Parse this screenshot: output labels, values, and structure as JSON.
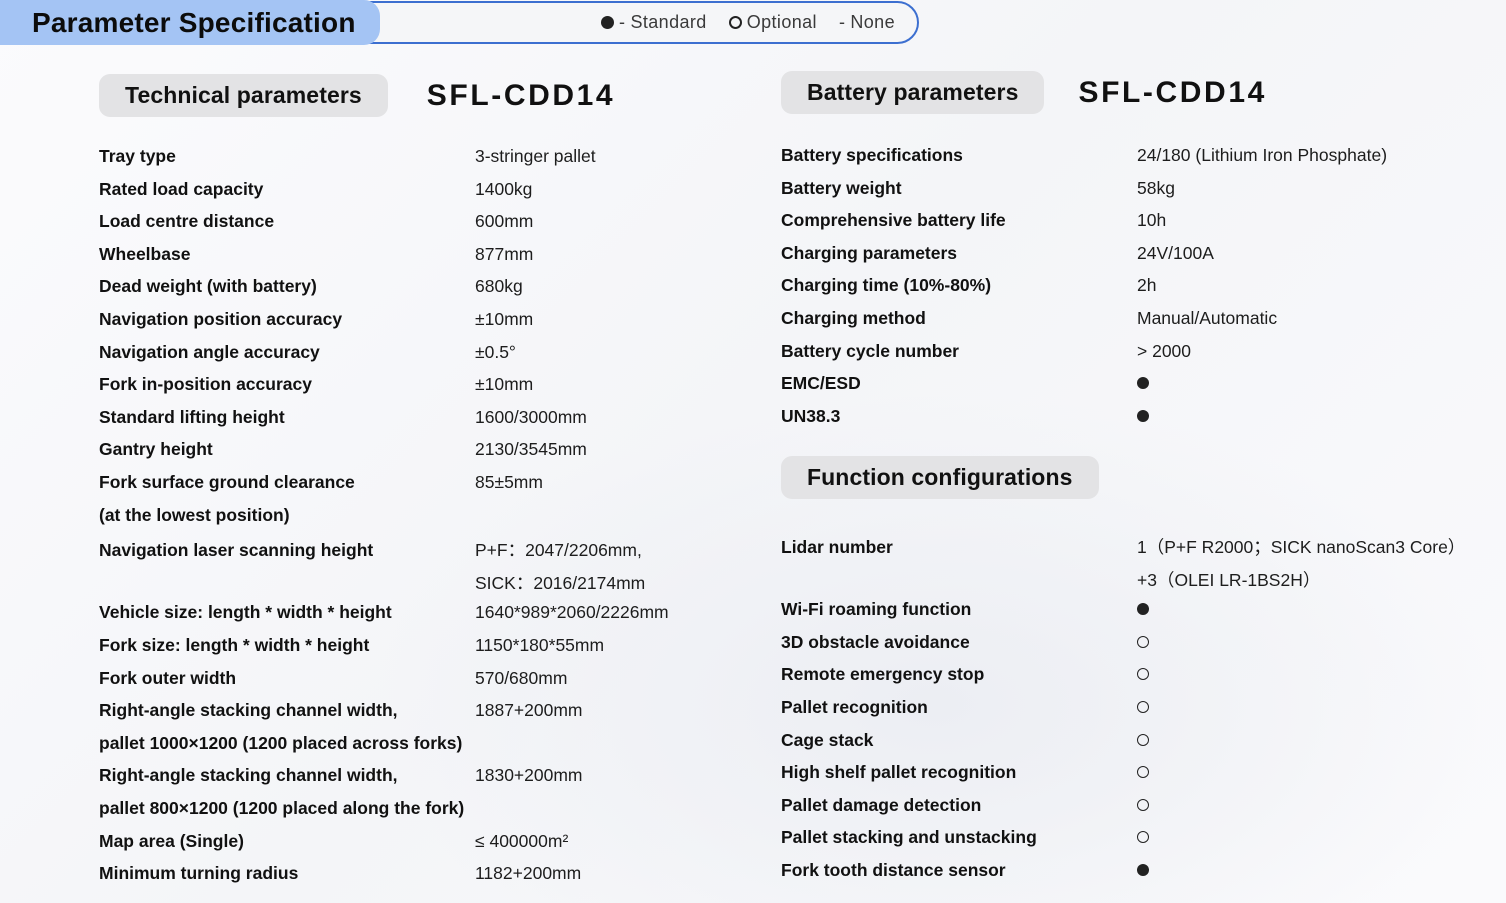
{
  "header": {
    "title": "Parameter Specification",
    "legend": [
      {
        "marker": "filled-dot",
        "dash": "-",
        "label": "Standard"
      },
      {
        "marker": "open-dot",
        "dash": "",
        "label": "Optional"
      },
      {
        "marker": "none",
        "dash": "-",
        "label": "None"
      }
    ]
  },
  "colors": {
    "title_badge": "#a4c4f4",
    "legend_border": "#3c6fd0",
    "pill": "#e3e3e5",
    "background": "#f7f7fa",
    "text": "#111111"
  },
  "sections": {
    "technical": {
      "heading": "Technical parameters",
      "model": "SFL-CDD14",
      "rows": [
        {
          "label": "Tray type",
          "value": "3-stringer pallet"
        },
        {
          "label": "Rated load capacity",
          "value": "1400kg"
        },
        {
          "label": "Load centre distance",
          "value": "600mm"
        },
        {
          "label": "Wheelbase",
          "value": "877mm"
        },
        {
          "label": "Dead weight (with battery)",
          "value": "680kg"
        },
        {
          "label": "Navigation position accuracy",
          "value": "±10mm"
        },
        {
          "label": "Navigation angle accuracy",
          "value": "±0.5°"
        },
        {
          "label": "Fork in-position accuracy",
          "value": "±10mm"
        },
        {
          "label": "Standard lifting height",
          "value": "1600/3000mm"
        },
        {
          "label": "Gantry height",
          "value": "2130/3545mm"
        },
        {
          "label": "Fork surface ground clearance",
          "value": "85±5mm"
        },
        {
          "label": "(at the lowest position)",
          "value": ""
        },
        {
          "label": "Navigation laser scanning height",
          "value": "P+F：2047/2206mm,"
        },
        {
          "label": "",
          "value": "SICK：2016/2174mm"
        },
        {
          "label": "Vehicle size: length * width * height",
          "value": "1640*989*2060/2226mm"
        },
        {
          "label": "Fork size: length * width * height",
          "value": "1150*180*55mm"
        },
        {
          "label": "Fork outer width",
          "value": "570/680mm"
        },
        {
          "label": "Right-angle stacking channel width,",
          "value": "1887+200mm"
        },
        {
          "label": "pallet 1000×1200 (1200 placed across forks)",
          "value": ""
        },
        {
          "label": "Right-angle stacking channel width,",
          "value": "1830+200mm"
        },
        {
          "label": "pallet 800×1200 (1200 placed along the fork)",
          "value": ""
        },
        {
          "label": "Map area (Single)",
          "value": "≤ 400000m²"
        },
        {
          "label": "Minimum turning radius",
          "value": "1182+200mm"
        }
      ]
    },
    "battery": {
      "heading": "Battery parameters",
      "model": "SFL-CDD14",
      "rows": [
        {
          "label": "Battery specifications",
          "value": "24/180 (Lithium Iron Phosphate)",
          "bold": false,
          "marker": ""
        },
        {
          "label": "Battery weight",
          "value": "58kg",
          "bold": false,
          "marker": ""
        },
        {
          "label": "Comprehensive battery life",
          "value": "10h",
          "bold": false,
          "marker": ""
        },
        {
          "label": "Charging parameters",
          "value": "24V/100A",
          "bold": false,
          "marker": ""
        },
        {
          "label": "Charging time (10%-80%)",
          "value": "2h",
          "bold": false,
          "marker": ""
        },
        {
          "label": "Charging method",
          "value": "Manual/Automatic",
          "bold": false,
          "marker": ""
        },
        {
          "label": "Battery cycle number",
          "value": "> 2000",
          "bold": false,
          "marker": ""
        },
        {
          "label": "EMC/ESD",
          "value": "",
          "bold": true,
          "marker": "filled-dot"
        },
        {
          "label": "UN38.3",
          "value": "",
          "bold": true,
          "marker": "filled-dot"
        }
      ]
    },
    "functions": {
      "heading": "Function configurations",
      "rows": [
        {
          "label": "Lidar number",
          "value": "1（P+F R2000；SICK nanoScan3 Core）",
          "marker": ""
        },
        {
          "label": "",
          "value": "+3（OLEI LR-1BS2H）",
          "marker": ""
        },
        {
          "label": "Wi-Fi roaming function",
          "value": "",
          "marker": "filled-dot"
        },
        {
          "label": "3D obstacle avoidance",
          "value": "",
          "marker": "open-dot"
        },
        {
          "label": "Remote emergency stop",
          "value": "",
          "marker": "open-dot"
        },
        {
          "label": "Pallet recognition",
          "value": "",
          "marker": "open-dot"
        },
        {
          "label": "Cage stack",
          "value": "",
          "marker": "open-dot"
        },
        {
          "label": "High shelf pallet recognition",
          "value": "",
          "marker": "open-dot"
        },
        {
          "label": "Pallet damage detection",
          "value": "",
          "marker": "open-dot"
        },
        {
          "label": "Pallet stacking and unstacking",
          "value": "",
          "marker": "open-dot"
        },
        {
          "label": "Fork tooth distance sensor",
          "value": "",
          "marker": "filled-dot"
        }
      ]
    }
  }
}
